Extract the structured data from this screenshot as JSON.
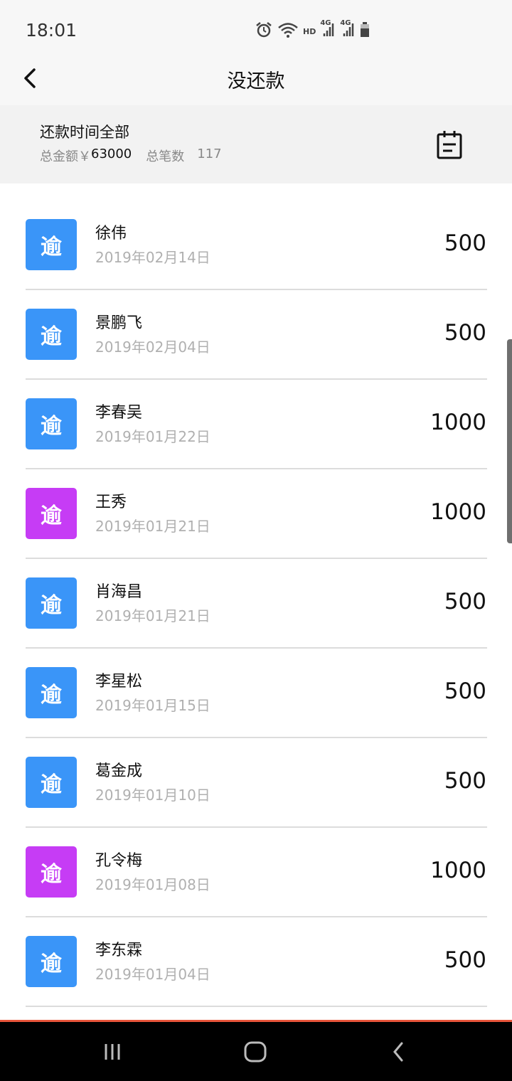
{
  "status_bar": {
    "time": "18:01",
    "hd": "HD",
    "signal1": "4G",
    "signal2": "4G"
  },
  "header": {
    "title": "没还款"
  },
  "summary": {
    "filter_label": "还款时间全部",
    "total_amount_label": "总金额￥",
    "total_amount": "63000",
    "count_label": "总笔数",
    "count": "117"
  },
  "colors": {
    "blue": "#3a95f8",
    "purple": "#c63cf5"
  },
  "loans": [
    {
      "badge": "逾",
      "color": "#3a95f8",
      "name": "徐伟",
      "date": "2019年02月14日",
      "amount": "500"
    },
    {
      "badge": "逾",
      "color": "#3a95f8",
      "name": "景鹏飞",
      "date": "2019年02月04日",
      "amount": "500"
    },
    {
      "badge": "逾",
      "color": "#3a95f8",
      "name": "李春吴",
      "date": "2019年01月22日",
      "amount": "1000"
    },
    {
      "badge": "逾",
      "color": "#c63cf5",
      "name": "王秀",
      "date": "2019年01月21日",
      "amount": "1000"
    },
    {
      "badge": "逾",
      "color": "#3a95f8",
      "name": "肖海昌",
      "date": "2019年01月21日",
      "amount": "500"
    },
    {
      "badge": "逾",
      "color": "#3a95f8",
      "name": "李星松",
      "date": "2019年01月15日",
      "amount": "500"
    },
    {
      "badge": "逾",
      "color": "#3a95f8",
      "name": "葛金成",
      "date": "2019年01月10日",
      "amount": "500"
    },
    {
      "badge": "逾",
      "color": "#c63cf5",
      "name": "孔令梅",
      "date": "2019年01月08日",
      "amount": "1000"
    },
    {
      "badge": "逾",
      "color": "#3a95f8",
      "name": "李东霖",
      "date": "2019年01月04日",
      "amount": "500"
    }
  ]
}
